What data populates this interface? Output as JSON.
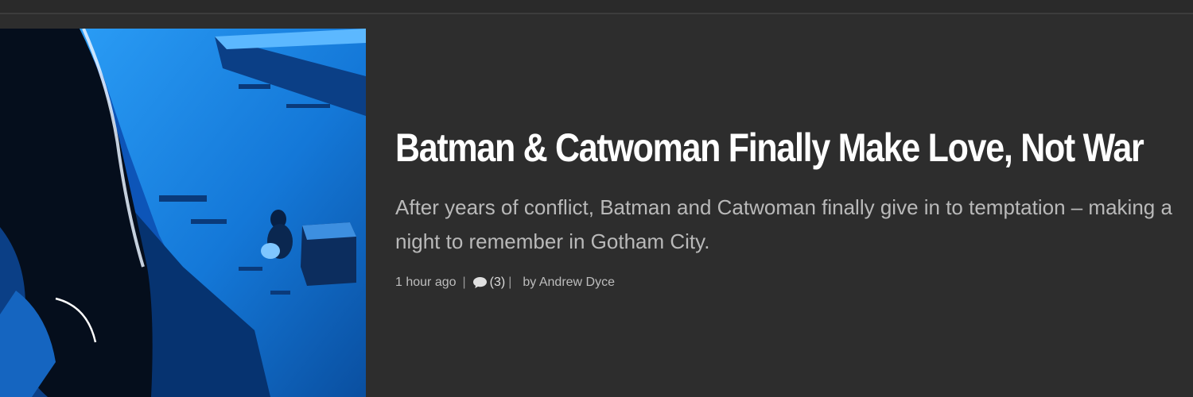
{
  "article": {
    "title": "Batman & Catwoman Finally Make Love, Not War",
    "excerpt": "After years of conflict, Batman and Catwoman finally give in to temptation – making a night to remember in Gotham City.",
    "meta": {
      "time": "1 hour ago",
      "separator": "|",
      "comments_count": "(3)",
      "author": "by Andrew Dyce"
    },
    "thumbnail_icon": "comic-panel-image"
  },
  "colors": {
    "background": "#2d2d2d",
    "title": "#ffffff",
    "excerpt": "#b9b9b9",
    "meta": "#bdbdbd",
    "image_blue": "#1e90ff"
  }
}
